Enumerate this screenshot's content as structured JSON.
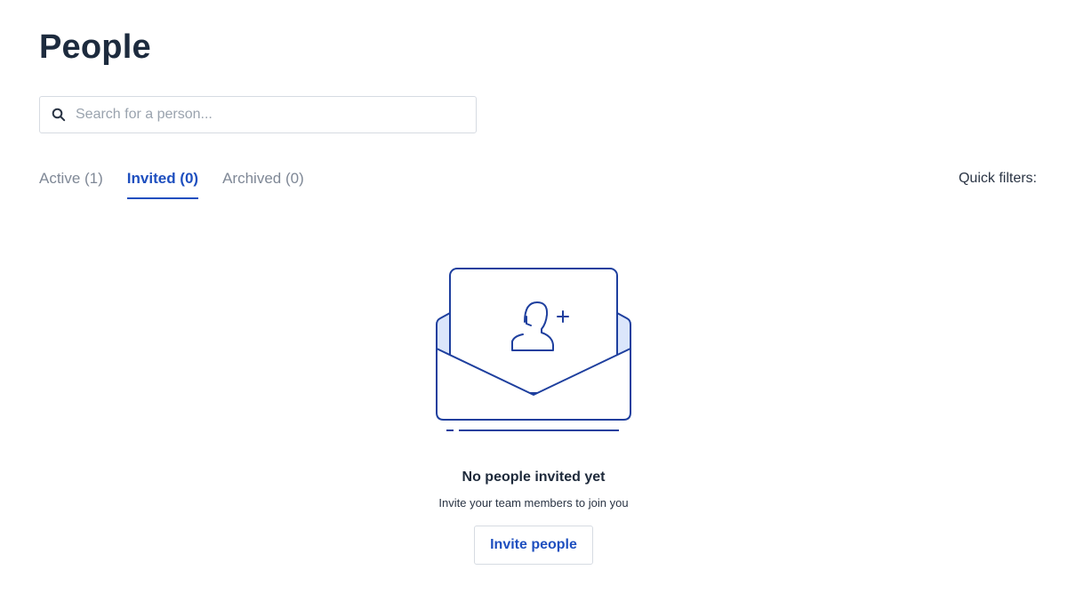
{
  "page": {
    "title": "People"
  },
  "search": {
    "placeholder": "Search for a person...",
    "value": ""
  },
  "tabs": [
    {
      "label": "Active (1)",
      "active": false
    },
    {
      "label": "Invited (0)",
      "active": true
    },
    {
      "label": "Archived (0)",
      "active": false
    }
  ],
  "quick_filters": {
    "label": "Quick filters:"
  },
  "empty_state": {
    "illustration": "envelope-invite-icon",
    "title": "No people invited yet",
    "subtitle": "Invite your team members to join you",
    "button_label": "Invite people"
  },
  "colors": {
    "accent": "#1e4fbf",
    "heading": "#1d2b3e",
    "muted_tab": "#7f8896",
    "illustration_fill": "#dbe6fb",
    "border": "#d6dbe2"
  }
}
